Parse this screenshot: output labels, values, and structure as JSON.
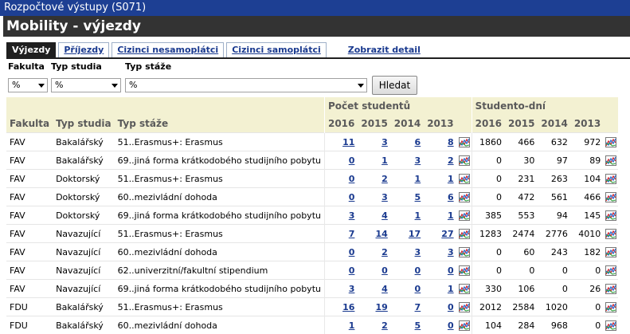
{
  "window": {
    "title": "Rozpočtové výstupy (S071)"
  },
  "page": {
    "title": "Mobility - výjezdy"
  },
  "tabs": [
    {
      "label": "Výjezdy"
    },
    {
      "label": "Příjezdy"
    },
    {
      "label": "Cizinci nesamoplátci"
    },
    {
      "label": "Cizinci samoplátci"
    },
    {
      "label": "Zobrazit detail"
    }
  ],
  "filters": {
    "fakulta_label": "Fakulta",
    "typ_studia_label": "Typ studia",
    "typ_staze_label": "Typ stáže",
    "fakulta_value": "%",
    "typ_studia_value": "%",
    "typ_staze_value": "%",
    "search_button": "Hledat"
  },
  "table": {
    "group_students": "Počet studentů",
    "group_days": "Studento-dní",
    "col_fakulta": "Fakulta",
    "col_typ_studia": "Typ studia",
    "col_typ_staze": "Typ stáže",
    "years": [
      "2016",
      "2015",
      "2014",
      "2013"
    ],
    "chart_icon": "chart-icon",
    "rows": [
      {
        "fakulta": "FAV",
        "typ_studia": "Bakalářský",
        "typ_staze": "51..Erasmus+: Erasmus",
        "s": [
          "11",
          "3",
          "6",
          "8"
        ],
        "d": [
          "1860",
          "466",
          "632",
          "972"
        ]
      },
      {
        "fakulta": "FAV",
        "typ_studia": "Bakalářský",
        "typ_staze": "69..jiná forma krátkodobého studijního pobytu",
        "s": [
          "0",
          "1",
          "3",
          "2"
        ],
        "d": [
          "0",
          "30",
          "97",
          "89"
        ]
      },
      {
        "fakulta": "FAV",
        "typ_studia": "Doktorský",
        "typ_staze": "51..Erasmus+: Erasmus",
        "s": [
          "0",
          "2",
          "1",
          "1"
        ],
        "d": [
          "0",
          "231",
          "263",
          "104"
        ]
      },
      {
        "fakulta": "FAV",
        "typ_studia": "Doktorský",
        "typ_staze": "60..mezivládní dohoda",
        "s": [
          "0",
          "3",
          "5",
          "6"
        ],
        "d": [
          "0",
          "472",
          "561",
          "466"
        ]
      },
      {
        "fakulta": "FAV",
        "typ_studia": "Doktorský",
        "typ_staze": "69..jiná forma krátkodobého studijního pobytu",
        "s": [
          "3",
          "4",
          "1",
          "1"
        ],
        "d": [
          "385",
          "553",
          "94",
          "145"
        ]
      },
      {
        "fakulta": "FAV",
        "typ_studia": "Navazující",
        "typ_staze": "51..Erasmus+: Erasmus",
        "s": [
          "7",
          "14",
          "17",
          "27"
        ],
        "d": [
          "1283",
          "2474",
          "2776",
          "4010"
        ]
      },
      {
        "fakulta": "FAV",
        "typ_studia": "Navazující",
        "typ_staze": "60..mezivládní dohoda",
        "s": [
          "0",
          "2",
          "3",
          "3"
        ],
        "d": [
          "0",
          "60",
          "243",
          "182"
        ]
      },
      {
        "fakulta": "FAV",
        "typ_studia": "Navazující",
        "typ_staze": "62..univerzitní/fakultní stipendium",
        "s": [
          "0",
          "0",
          "0",
          "0"
        ],
        "d": [
          "0",
          "0",
          "0",
          "0"
        ]
      },
      {
        "fakulta": "FAV",
        "typ_studia": "Navazující",
        "typ_staze": "69..jiná forma krátkodobého studijního pobytu",
        "s": [
          "3",
          "4",
          "0",
          "1"
        ],
        "d": [
          "330",
          "106",
          "0",
          "26"
        ]
      },
      {
        "fakulta": "FDU",
        "typ_studia": "Bakalářský",
        "typ_staze": "51..Erasmus+: Erasmus",
        "s": [
          "16",
          "19",
          "7",
          "0"
        ],
        "d": [
          "2012",
          "2584",
          "1020",
          "0"
        ]
      },
      {
        "fakulta": "FDU",
        "typ_studia": "Bakalářský",
        "typ_staze": "60..mezivládní dohoda",
        "s": [
          "1",
          "2",
          "5",
          "0"
        ],
        "d": [
          "104",
          "284",
          "968",
          "0"
        ]
      }
    ]
  }
}
